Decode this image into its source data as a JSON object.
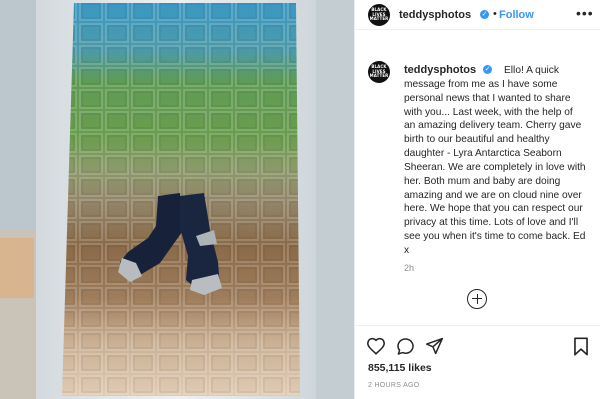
{
  "post": {
    "username": "teddysphotos",
    "avatar_text": [
      "BLACK",
      "LIVES",
      "MATTER"
    ],
    "follow_label": "Follow",
    "separator": "•",
    "more_label": "•••",
    "caption_text": "Ello! A quick message from me as I have some personal news that I wanted to share with you... Last week, with the help of an amazing delivery team. Cherry gave birth to our beautiful and healthy daughter - Lyra Antarctica Seaborn Sheeran. We are completely in love with her. Both mum and baby are doing amazing and we are on cloud nine over here. We hope that you can respect our privacy at this time. Lots of love and I'll see you when it's time to come back. Ed x",
    "time_ago": "2h",
    "likes": "855,115 likes",
    "posted": "2 HOURS AGO"
  },
  "icons": {
    "verified": "verified-badge-icon",
    "load_more": "plus-circle-icon",
    "like": "heart-icon",
    "comment": "comment-bubble-icon",
    "share": "paper-plane-icon",
    "save": "bookmark-icon"
  },
  "colors": {
    "link_blue": "#3897f0",
    "text": "#262626",
    "muted": "#8e8e8e",
    "blanket_top": "#3f97c0",
    "blanket_green": "#5f9a4e",
    "blanket_brown": "#8c6d4a",
    "blanket_bottom": "#d9c6b0",
    "socks": "#17213a"
  }
}
